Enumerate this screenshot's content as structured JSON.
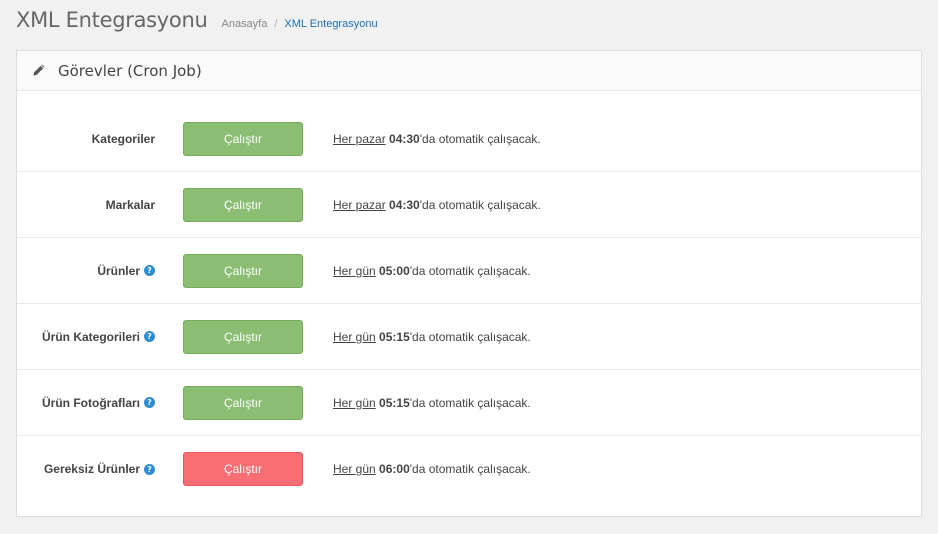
{
  "header": {
    "title": "XML Entegrasyonu",
    "breadcrumb": {
      "home": "Anasayfa",
      "separator": "/",
      "current": "XML Entegrasyonu"
    }
  },
  "panel": {
    "title": "Görevler (Cron Job)",
    "icon": "pencil-icon"
  },
  "colors": {
    "green_button": "#8bbe73",
    "red_button": "#f96d73",
    "link_blue": "#1e6fb4",
    "help_icon_blue": "#2d8cd4"
  },
  "jobs": [
    {
      "label": "Kategoriler",
      "has_help": false,
      "button": "Çalıştır",
      "button_color": "green",
      "frequency": "Her pazar",
      "time": "04:30",
      "suffix": "'da otomatik çalışacak."
    },
    {
      "label": "Markalar",
      "has_help": false,
      "button": "Çalıştır",
      "button_color": "green",
      "frequency": "Her pazar",
      "time": "04:30",
      "suffix": "'da otomatik çalışacak."
    },
    {
      "label": "Ürünler",
      "has_help": true,
      "button": "Çalıştır",
      "button_color": "green",
      "frequency": "Her gün",
      "time": "05:00",
      "suffix": "'da otomatik çalışacak."
    },
    {
      "label": "Ürün Kategorileri",
      "has_help": true,
      "button": "Çalıştır",
      "button_color": "green",
      "frequency": "Her gün",
      "time": "05:15",
      "suffix": "'da otomatik çalışacak."
    },
    {
      "label": "Ürün Fotoğrafları",
      "has_help": true,
      "button": "Çalıştır",
      "button_color": "green",
      "frequency": "Her gün",
      "time": "05:15",
      "suffix": "'da otomatik çalışacak."
    },
    {
      "label": "Gereksiz Ürünler",
      "has_help": true,
      "button": "Çalıştır",
      "button_color": "red",
      "frequency": "Her gün",
      "time": "06:00",
      "suffix": "'da otomatik çalışacak."
    }
  ]
}
